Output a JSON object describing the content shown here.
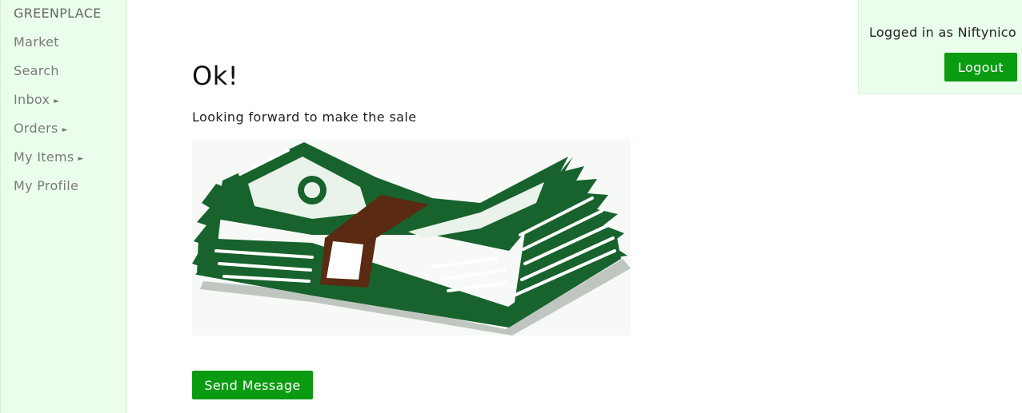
{
  "sidebar": {
    "brand": "GREENPLACE",
    "items": [
      {
        "label": "Market",
        "arrow": ""
      },
      {
        "label": "Search",
        "arrow": ""
      },
      {
        "label": "Inbox",
        "arrow": "►"
      },
      {
        "label": "Orders",
        "arrow": "►"
      },
      {
        "label": "My Items",
        "arrow": "►"
      },
      {
        "label": "My Profile",
        "arrow": ""
      }
    ]
  },
  "main": {
    "title": "Ok!",
    "message": "Looking forward to make the sale",
    "image_icon": "money-stack-icon",
    "send_label": "Send Message"
  },
  "user": {
    "logged_in_text": "Logged in as Niftynico",
    "logout_label": "Logout"
  },
  "colors": {
    "accent": "#0a9b11",
    "panel_bg": "#ebfdeb",
    "money_green": "#17622d",
    "band_brown": "#5a2a12"
  }
}
